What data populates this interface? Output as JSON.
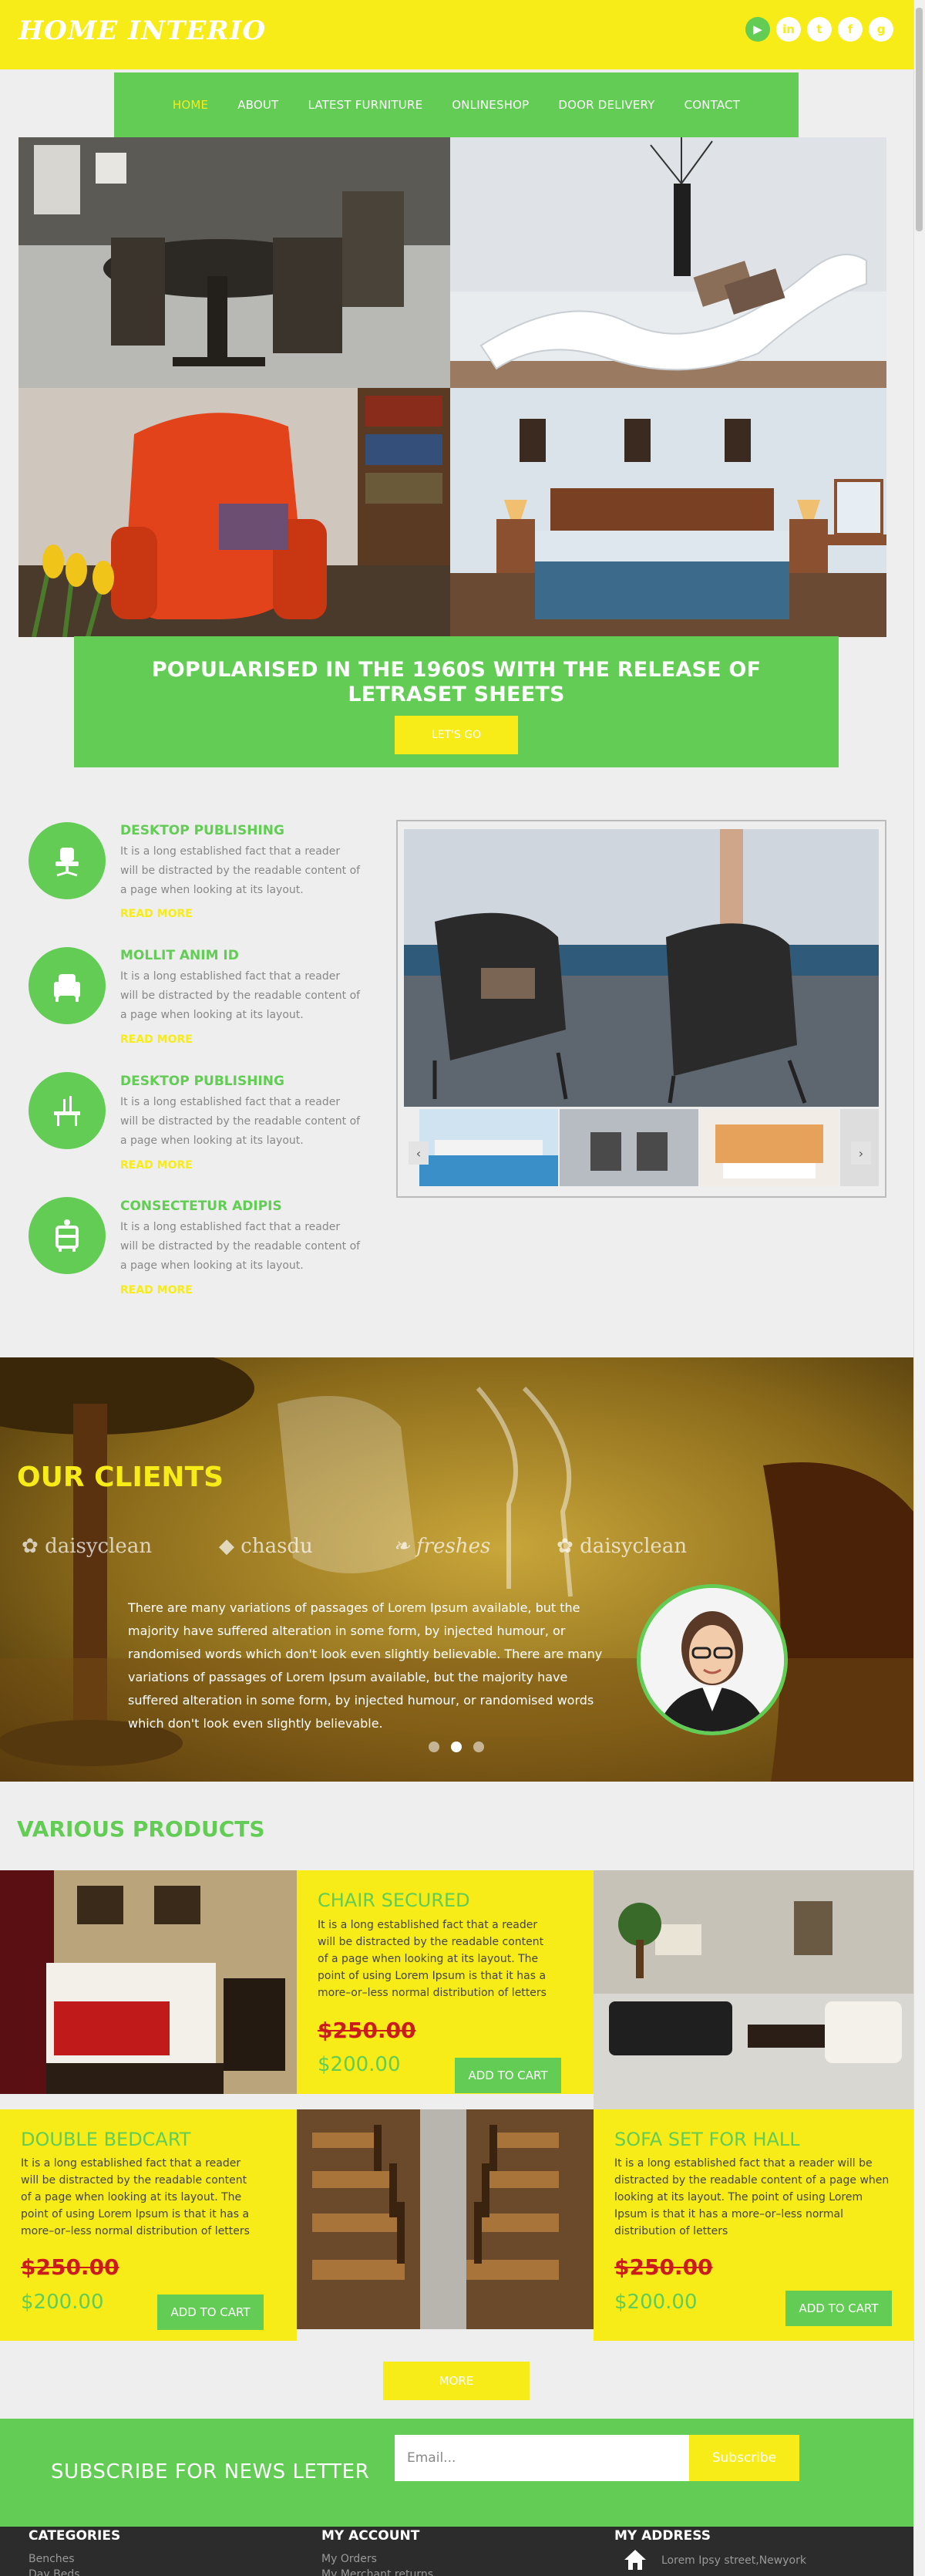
{
  "brand": {
    "logo": "HOME INTERIO"
  },
  "social": [
    "youtube-icon",
    "linkedin-icon",
    "twitter-icon",
    "facebook-icon",
    "google-plus-icon"
  ],
  "nav": {
    "items": [
      {
        "label": "HOME",
        "active": true
      },
      {
        "label": "ABOUT"
      },
      {
        "label": "LATEST FURNITURE"
      },
      {
        "label": "ONLINESHOP"
      },
      {
        "label": "DOOR DELIVERY"
      },
      {
        "label": "CONTACT"
      }
    ]
  },
  "hero": {
    "title": "POPULARISED IN THE 1960S WITH THE RELEASE OF LETRASET SHEETS",
    "button": "LET'S GO"
  },
  "features": [
    {
      "title": "DESKTOP PUBLISHING",
      "text": "It is a long established fact that a reader will be distracted by the readable content of a page when looking at its layout.",
      "more": "READ MORE",
      "icon": "office-chair-icon"
    },
    {
      "title": "MOLLIT ANIM ID",
      "text": "It is a long established fact that a reader will be distracted by the readable content of a page when looking at its layout.",
      "more": "READ MORE",
      "icon": "armchair-icon"
    },
    {
      "title": "DESKTOP PUBLISHING",
      "text": "It is a long established fact that a reader will be distracted by the readable content of a page when looking at its layout.",
      "more": "READ MORE",
      "icon": "dining-table-icon"
    },
    {
      "title": "CONSECTETUR ADIPIS",
      "text": "It is a long established fact that a reader will be distracted by the readable content of a page when looking at its layout.",
      "more": "READ MORE",
      "icon": "cabinet-icon"
    }
  ],
  "clients": {
    "title": "OUR CLIENTS",
    "logos": [
      "daisyclean",
      "chasdu",
      "freshes",
      "daisyclean"
    ],
    "text": "There are many variations of passages of Lorem Ipsum available, but the majority have suffered alteration in some form, by injected humour, or randomised words which don't look even slightly believable. There are many variations of passages of Lorem Ipsum available, but the majority have suffered alteration in some form, by injected humour, or randomised words which don't look even slightly believable."
  },
  "products": {
    "title": "VARIOUS PRODUCTS",
    "items": [
      {
        "title": "CHAIR SECURED",
        "desc": "It is a long established fact that a reader will be distracted by the readable content of a page when looking at its layout. The point of using Lorem Ipsum is that it has a more–or–less normal distribution of letters",
        "old_price": "$250.00",
        "new_price": "$200.00",
        "button": "ADD TO CART"
      },
      {
        "title": "DOUBLE BEDCART",
        "desc": "It is a long established fact that a reader will be distracted by the readable content of a page when looking at its layout. The point of using Lorem Ipsum is that it has a more–or–less normal distribution of letters",
        "old_price": "$250.00",
        "new_price": "$200.00",
        "button": "ADD TO CART"
      },
      {
        "title": "SOFA SET FOR HALL",
        "desc": "It is a long established fact that a reader will be distracted by the readable content of a page when looking at its layout. The point of using Lorem Ipsum is that it has a more–or–less normal distribution of letters",
        "old_price": "$250.00",
        "new_price": "$200.00",
        "button": "ADD TO CART"
      }
    ],
    "more": "MORE"
  },
  "newsletter": {
    "title": "SUBSCRIBE FOR NEWS LETTER",
    "placeholder": "Email...",
    "button": "Subscribe"
  },
  "footer": {
    "categories": {
      "title": "CATEGORIES",
      "links": [
        "Benches",
        "Day Beds"
      ]
    },
    "account": {
      "title": "MY ACCOUNT",
      "links": [
        "My Orders",
        "My Merchant returns"
      ]
    },
    "address": {
      "title": "MY ADDRESS",
      "line": "Lorem Ipsy street,Newyork"
    }
  },
  "colors": {
    "yellow": "#f7ec17",
    "green": "#62cc55",
    "dark": "#2c2c2c"
  }
}
